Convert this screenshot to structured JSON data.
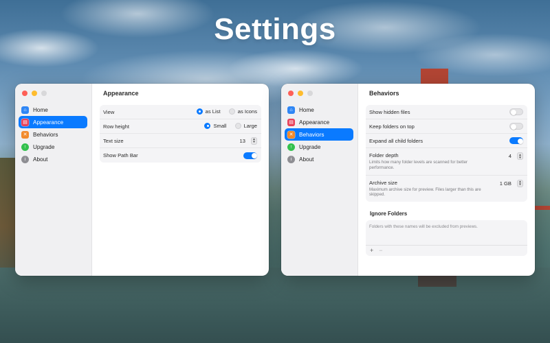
{
  "headline": "Settings",
  "nav": [
    {
      "label": "Home",
      "icon": "house-icon"
    },
    {
      "label": "Appearance",
      "icon": "appearance-icon"
    },
    {
      "label": "Behaviors",
      "icon": "behaviors-icon"
    },
    {
      "label": "Upgrade",
      "icon": "upgrade-icon"
    },
    {
      "label": "About",
      "icon": "info-icon"
    }
  ],
  "left_window": {
    "title": "Appearance",
    "active_nav": "Appearance",
    "view": {
      "label": "View",
      "option1": "as List",
      "option2": "as Icons",
      "selected": "as List"
    },
    "row_height": {
      "label": "Row height",
      "option1": "Small",
      "option2": "Large",
      "selected": "Small"
    },
    "text_size": {
      "label": "Text size",
      "value": "13"
    },
    "show_path_bar": {
      "label": "Show Path Bar",
      "on": true
    }
  },
  "right_window": {
    "title": "Behaviors",
    "active_nav": "Behaviors",
    "show_hidden": {
      "label": "Show hidden files",
      "on": false
    },
    "folders_on_top": {
      "label": "Keep folders on top",
      "on": false
    },
    "expand_children": {
      "label": "Expand all child folders",
      "on": true
    },
    "folder_depth": {
      "label": "Folder depth",
      "description": "Limits how many folder levels are scanned for better performance.",
      "value": "4"
    },
    "archive_size": {
      "label": "Archive size",
      "description": "Maximum archive size for preview. Files larger than this are skipped.",
      "value": "1 GB"
    },
    "ignore_title": "Ignore Folders",
    "ignore_placeholder": "Folders with these names will be excluded from previews.",
    "add_symbol": "+",
    "remove_symbol": "−"
  },
  "colors": {
    "accent": "#0a7aff",
    "close": "#fe5f57",
    "minimize": "#febc2e"
  }
}
